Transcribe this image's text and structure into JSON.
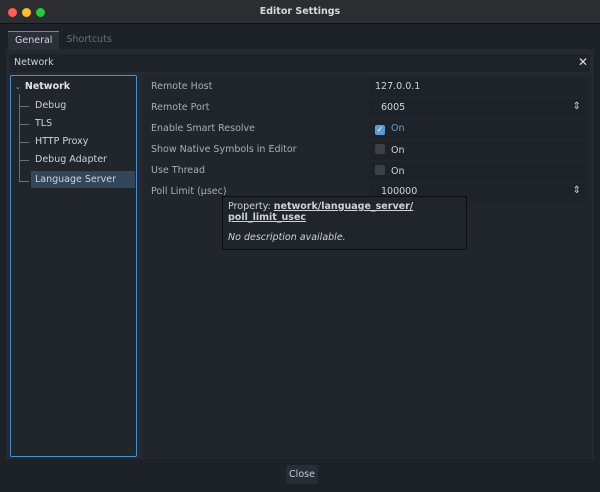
{
  "window": {
    "title": "Editor Settings"
  },
  "tabs": [
    {
      "label": "General",
      "active": true
    },
    {
      "label": "Shortcuts",
      "active": false
    }
  ],
  "search": {
    "value": "Network"
  },
  "tree": {
    "root": "Network",
    "items": [
      "Debug",
      "TLS",
      "HTTP Proxy",
      "Debug Adapter",
      "Language Server"
    ],
    "selected": "Language Server"
  },
  "properties": [
    {
      "label": "Remote Host",
      "value": "127.0.0.1",
      "type": "text"
    },
    {
      "label": "Remote Port",
      "value": "6005",
      "type": "spin"
    },
    {
      "label": "Enable Smart Resolve",
      "value": "On",
      "type": "check",
      "checked": true
    },
    {
      "label": "Show Native Symbols in Editor",
      "value": "On",
      "type": "check",
      "checked": false
    },
    {
      "label": "Use Thread",
      "value": "On",
      "type": "check",
      "checked": false
    },
    {
      "label": "Poll Limit (µsec)",
      "value": "100000",
      "type": "spin"
    }
  ],
  "tooltip": {
    "prefix": "Property: ",
    "path1": "network/language_server/",
    "path2": "poll_limit_usec",
    "description": "No description available."
  },
  "footer": {
    "close_label": "Close"
  },
  "colors": {
    "accent": "#4a90cf",
    "close": "#ff5f57",
    "minimize": "#febc2e",
    "maximize": "#28c840"
  }
}
